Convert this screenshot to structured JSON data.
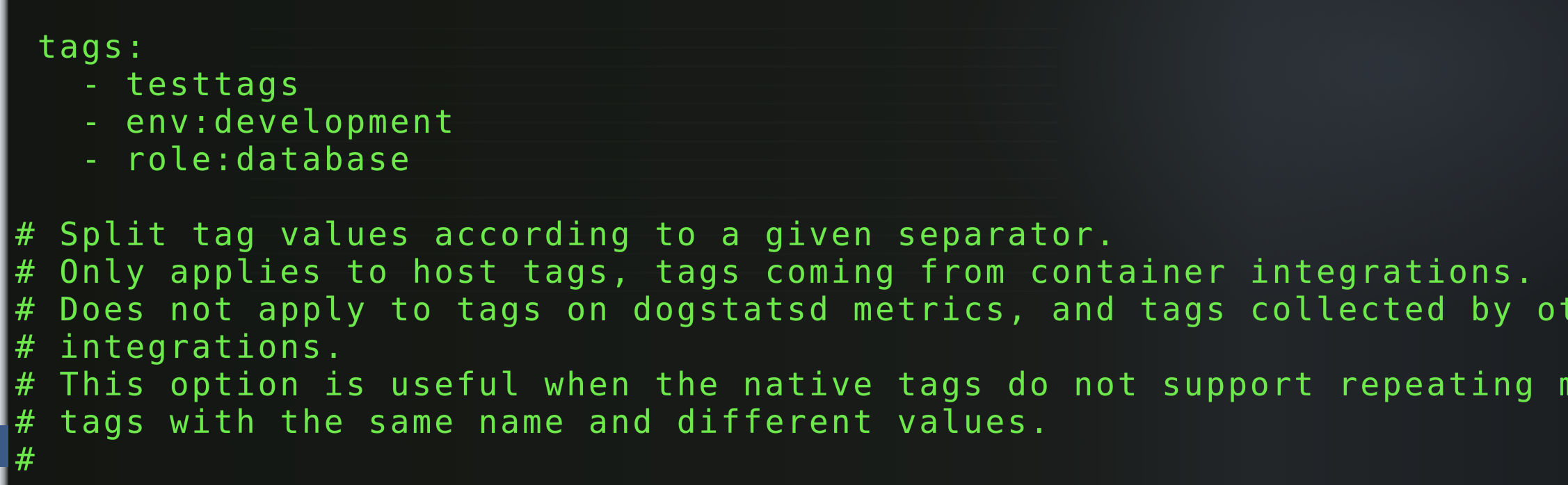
{
  "terminal": {
    "text_color": "#6ee84d",
    "lines": [
      " tags:",
      "   - testtags",
      "   - env:development",
      "   - role:database",
      "",
      "# Split tag values according to a given separator.",
      "# Only applies to host tags, tags coming from container integrations.",
      "# Does not apply to tags on dogstatsd metrics, and tags collected by other",
      "# integrations.",
      "# This option is useful when the native tags do not support repeating multiple",
      "# tags with the same name and different values.",
      "#"
    ]
  }
}
